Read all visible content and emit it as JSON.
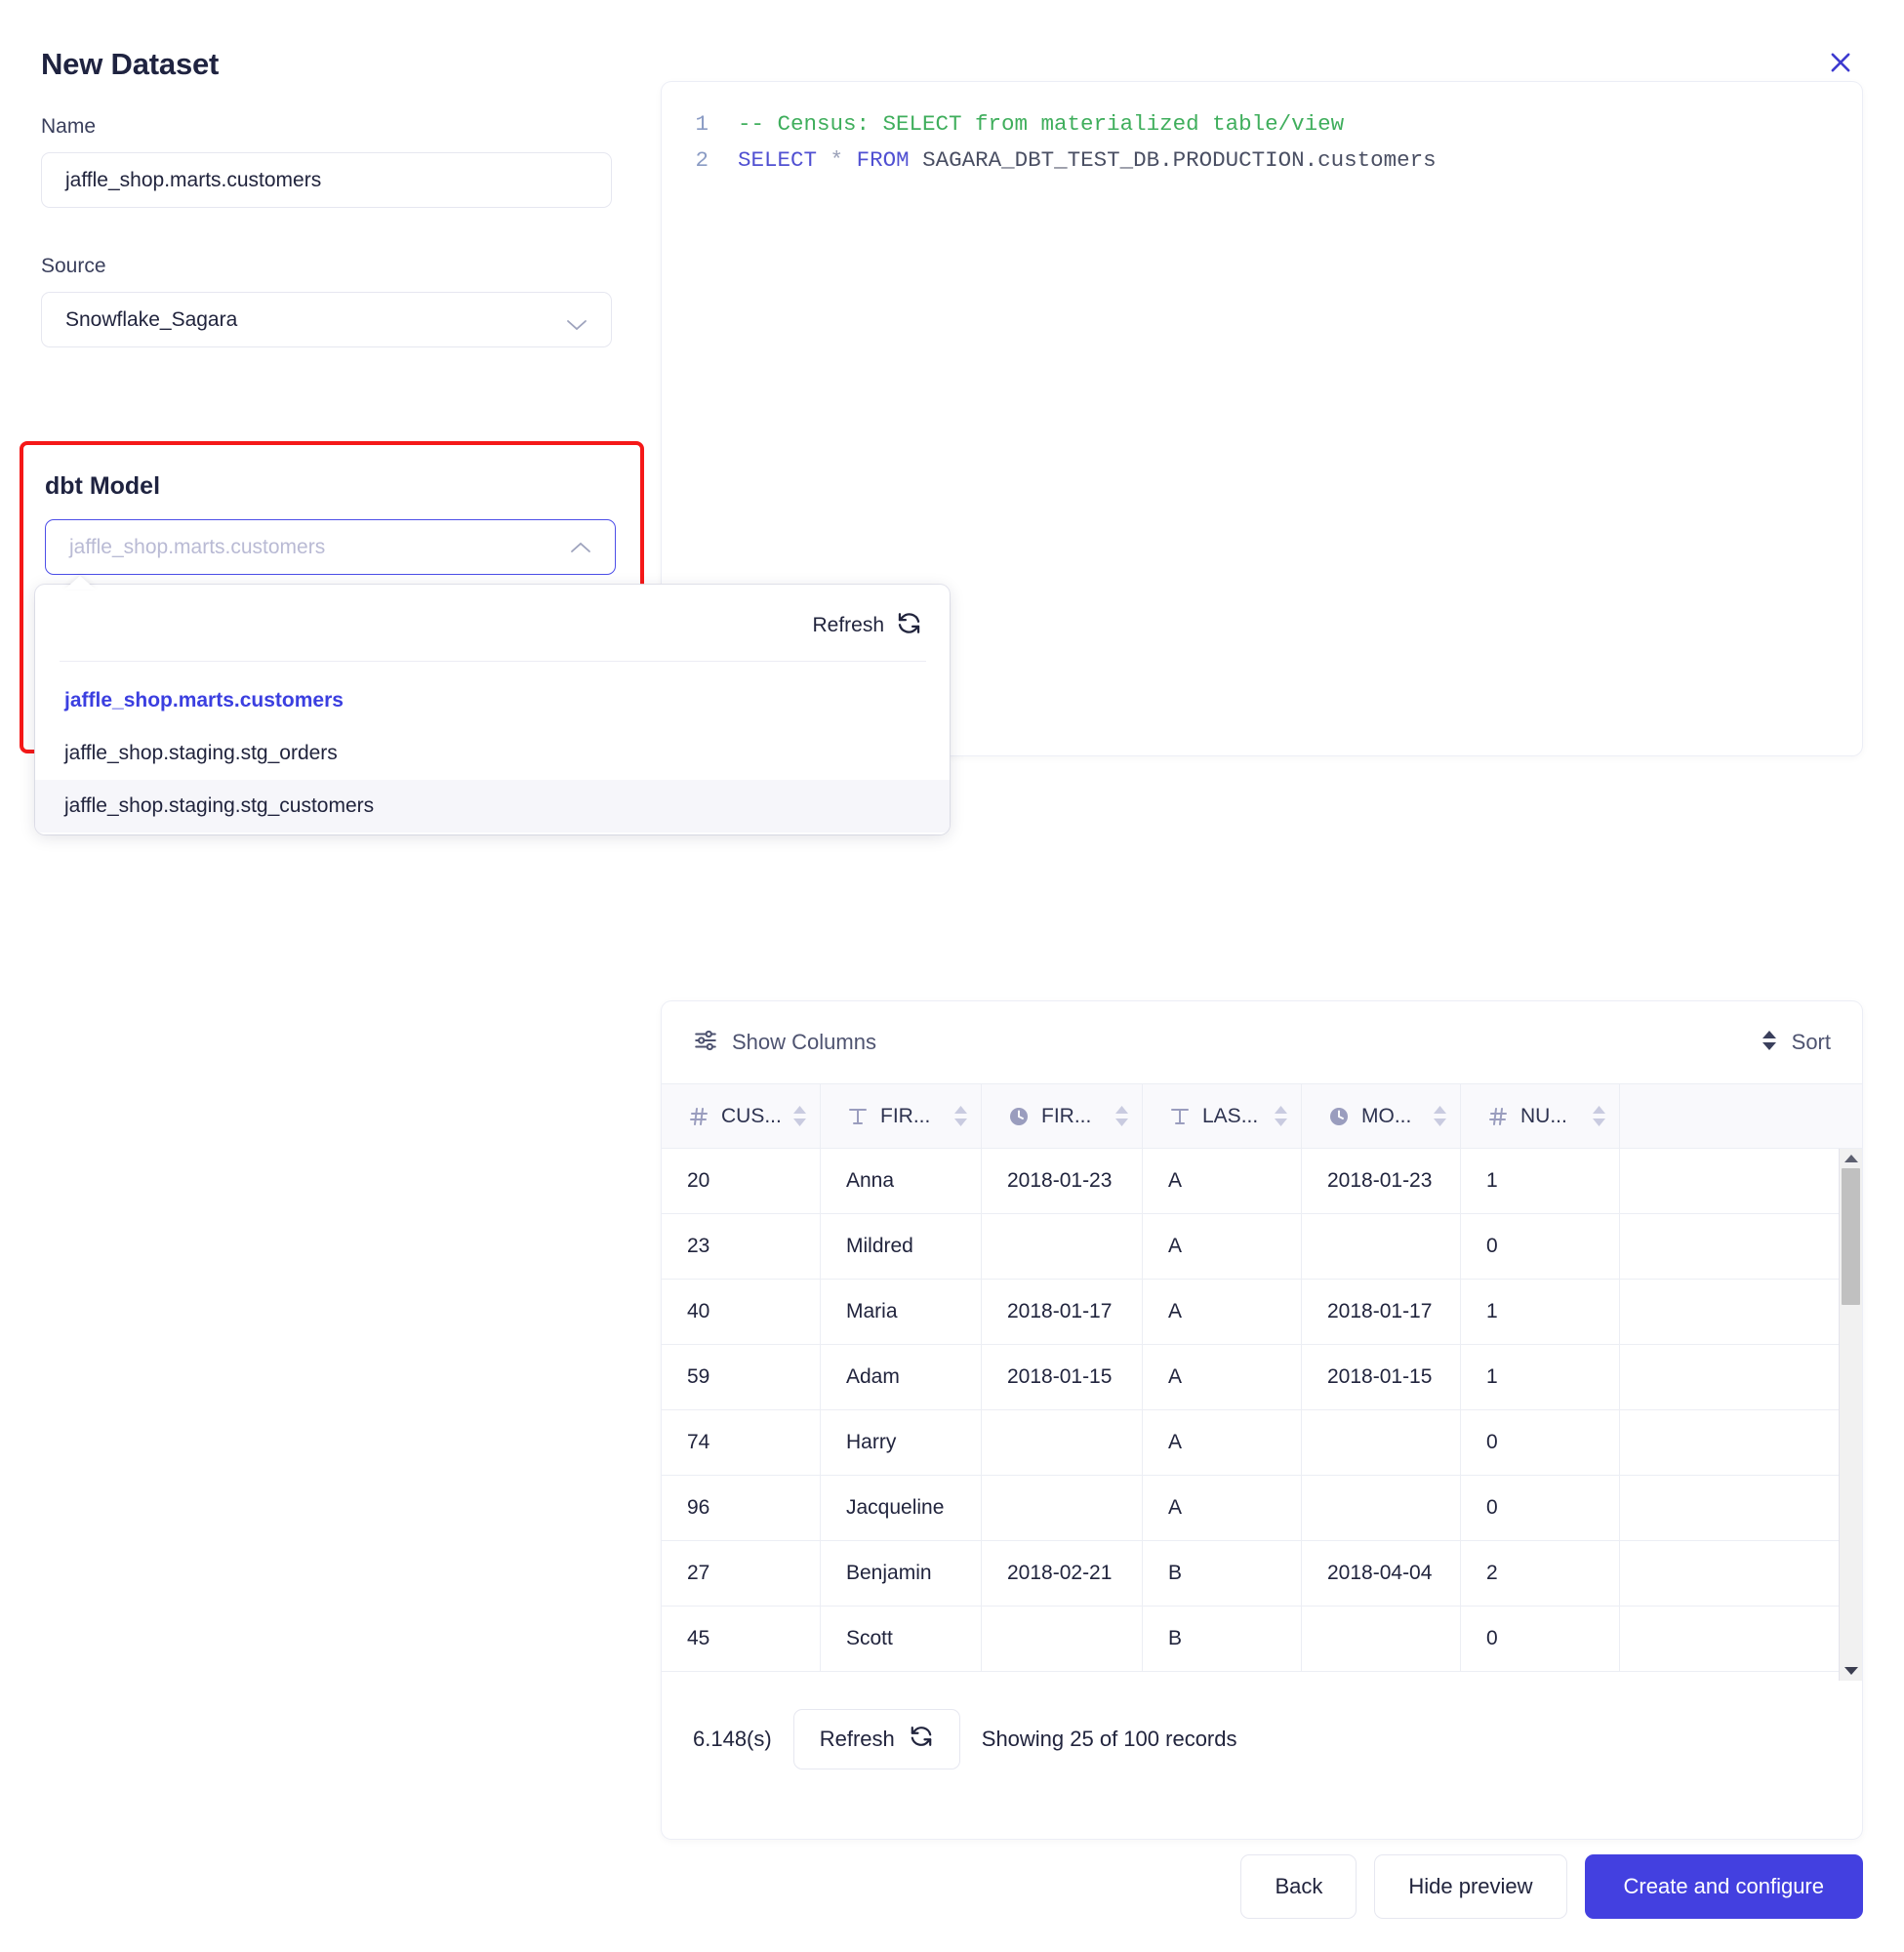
{
  "modal": {
    "title": "New Dataset",
    "close_icon": "close-icon"
  },
  "form": {
    "name_label": "Name",
    "name_value": "jaffle_shop.marts.customers",
    "source_label": "Source",
    "source_value": "Snowflake_Sagara",
    "dbt_model_label": "dbt Model",
    "dbt_model_placeholder": "jaffle_shop.marts.customers",
    "dropdown": {
      "refresh_label": "Refresh",
      "items": [
        {
          "label": "jaffle_shop.marts.customers",
          "selected": true,
          "hovered": false
        },
        {
          "label": "jaffle_shop.staging.stg_orders",
          "selected": false,
          "hovered": false
        },
        {
          "label": "jaffle_shop.staging.stg_customers",
          "selected": false,
          "hovered": true
        }
      ]
    }
  },
  "sql_editor": {
    "lines": [
      {
        "number": "1",
        "comment": "-- Census: SELECT from materialized table/view"
      },
      {
        "number": "2",
        "kw1": "SELECT",
        "op": "*",
        "kw2": "FROM",
        "ident": "SAGARA_DBT_TEST_DB.PRODUCTION.customers"
      }
    ]
  },
  "preview": {
    "show_columns_label": "Show Columns",
    "sort_label": "Sort",
    "columns": [
      {
        "type_icon": "hash-icon",
        "label": "CUS..."
      },
      {
        "type_icon": "text-icon",
        "label": "FIR..."
      },
      {
        "type_icon": "clock-icon",
        "label": "FIR..."
      },
      {
        "type_icon": "text-icon",
        "label": "LAS..."
      },
      {
        "type_icon": "clock-icon",
        "label": "MO..."
      },
      {
        "type_icon": "hash-icon",
        "label": "NU..."
      },
      {
        "type_icon": "",
        "label": ""
      }
    ],
    "rows": [
      [
        "20",
        "Anna",
        "2018-01-23",
        "A",
        "2018-01-23",
        "1",
        ""
      ],
      [
        "23",
        "Mildred",
        "",
        "A",
        "",
        "0",
        ""
      ],
      [
        "40",
        "Maria",
        "2018-01-17",
        "A",
        "2018-01-17",
        "1",
        ""
      ],
      [
        "59",
        "Adam",
        "2018-01-15",
        "A",
        "2018-01-15",
        "1",
        ""
      ],
      [
        "74",
        "Harry",
        "",
        "A",
        "",
        "0",
        ""
      ],
      [
        "96",
        "Jacqueline",
        "",
        "A",
        "",
        "0",
        ""
      ],
      [
        "27",
        "Benjamin",
        "2018-02-21",
        "B",
        "2018-04-04",
        "2",
        ""
      ],
      [
        "45",
        "Scott",
        "",
        "B",
        "",
        "0",
        ""
      ]
    ],
    "footer": {
      "duration": "6.148(s)",
      "refresh_label": "Refresh",
      "records_label": "Showing 25 of 100 records"
    }
  },
  "actions": {
    "back_label": "Back",
    "hide_preview_label": "Hide preview",
    "create_label": "Create and configure"
  },
  "colors": {
    "accent": "#4340e0",
    "highlight_border": "#f51818",
    "selected_item": "#3b3fe0",
    "comment_green": "#3fae5c",
    "keyword_blue": "#5050d2"
  }
}
